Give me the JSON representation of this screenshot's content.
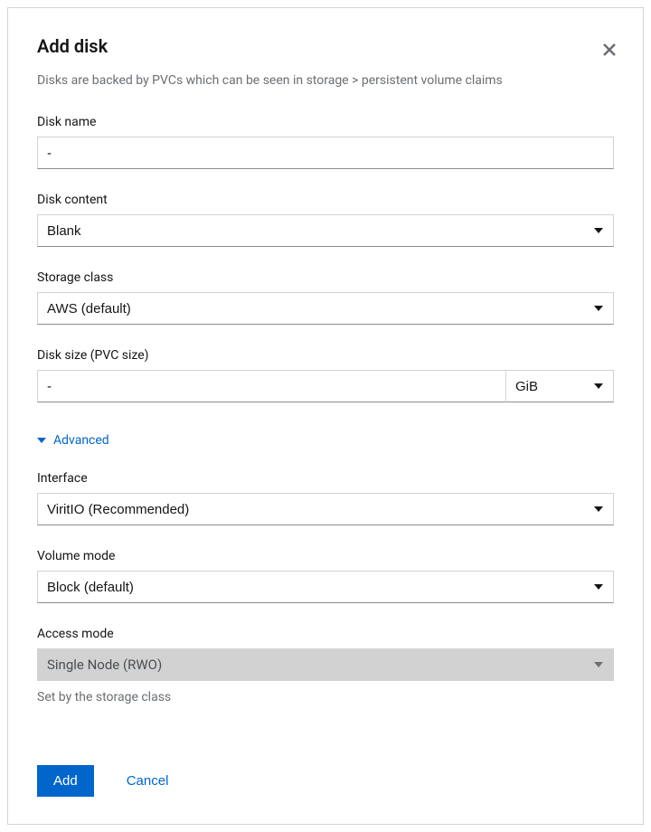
{
  "modal": {
    "title": "Add disk",
    "description": "Disks are backed by PVCs which can be seen in storage > persistent volume claims"
  },
  "fields": {
    "diskName": {
      "label": "Disk name",
      "value": "-"
    },
    "diskContent": {
      "label": "Disk content",
      "value": "Blank"
    },
    "storageClass": {
      "label": "Storage class",
      "value": "AWS (default)"
    },
    "diskSize": {
      "label": "Disk size (PVC size)",
      "value": "-",
      "unit": "GiB"
    },
    "interface": {
      "label": "Interface",
      "value": "ViritIO (Recommended)"
    },
    "volumeMode": {
      "label": "Volume mode",
      "value": "Block (default)"
    },
    "accessMode": {
      "label": "Access mode",
      "value": "Single Node (RWO)",
      "helper": "Set by the storage class"
    }
  },
  "advanced": {
    "label": "Advanced"
  },
  "footer": {
    "primary": "Add",
    "cancel": "Cancel"
  }
}
